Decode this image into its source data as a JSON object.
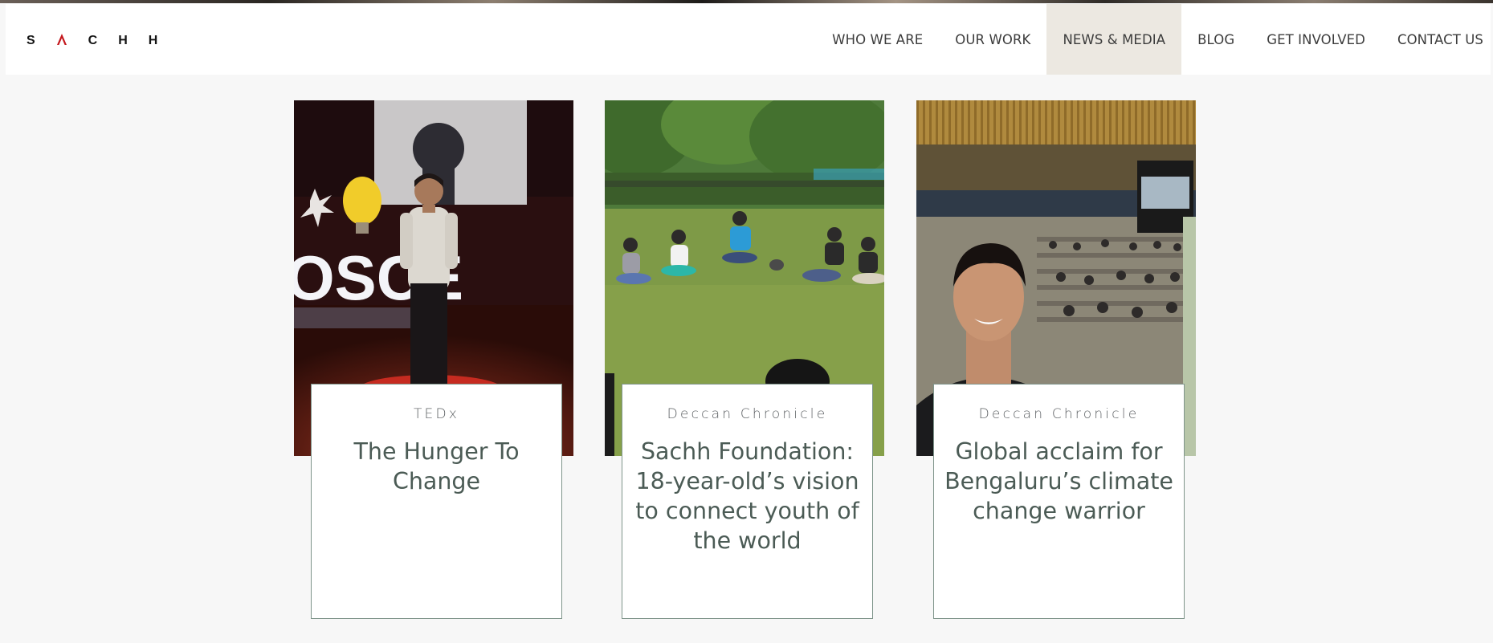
{
  "header": {
    "logo_letters": [
      "S",
      "A",
      "C",
      "H",
      "H"
    ],
    "nav": [
      {
        "label": "WHO WE ARE",
        "active": false
      },
      {
        "label": "OUR WORK",
        "active": false
      },
      {
        "label": "NEWS & MEDIA",
        "active": true
      },
      {
        "label": "BLOG",
        "active": false
      },
      {
        "label": "GET INVOLVED",
        "active": false
      },
      {
        "label": "CONTACT US",
        "active": false
      }
    ]
  },
  "cards": [
    {
      "source": "TEDx",
      "title": "The Hunger To Change",
      "image": "speaker-on-stage-photo"
    },
    {
      "source": "Deccan Chronicle",
      "title": "Sachh Foundation: 18-year-old’s vision to connect youth of the world",
      "image": "youth-circle-in-park-photo"
    },
    {
      "source": "Deccan Chronicle",
      "title": "Global acclaim for Bengaluru’s climate change warrior",
      "image": "selfie-at-un-assembly-photo"
    }
  ],
  "colors": {
    "background": "#f7f7f7",
    "nav_active_bg": "#ece8e1",
    "logo_accent": "#c4171c",
    "card_border": "#7f958b",
    "title_text": "#4b5b55"
  }
}
